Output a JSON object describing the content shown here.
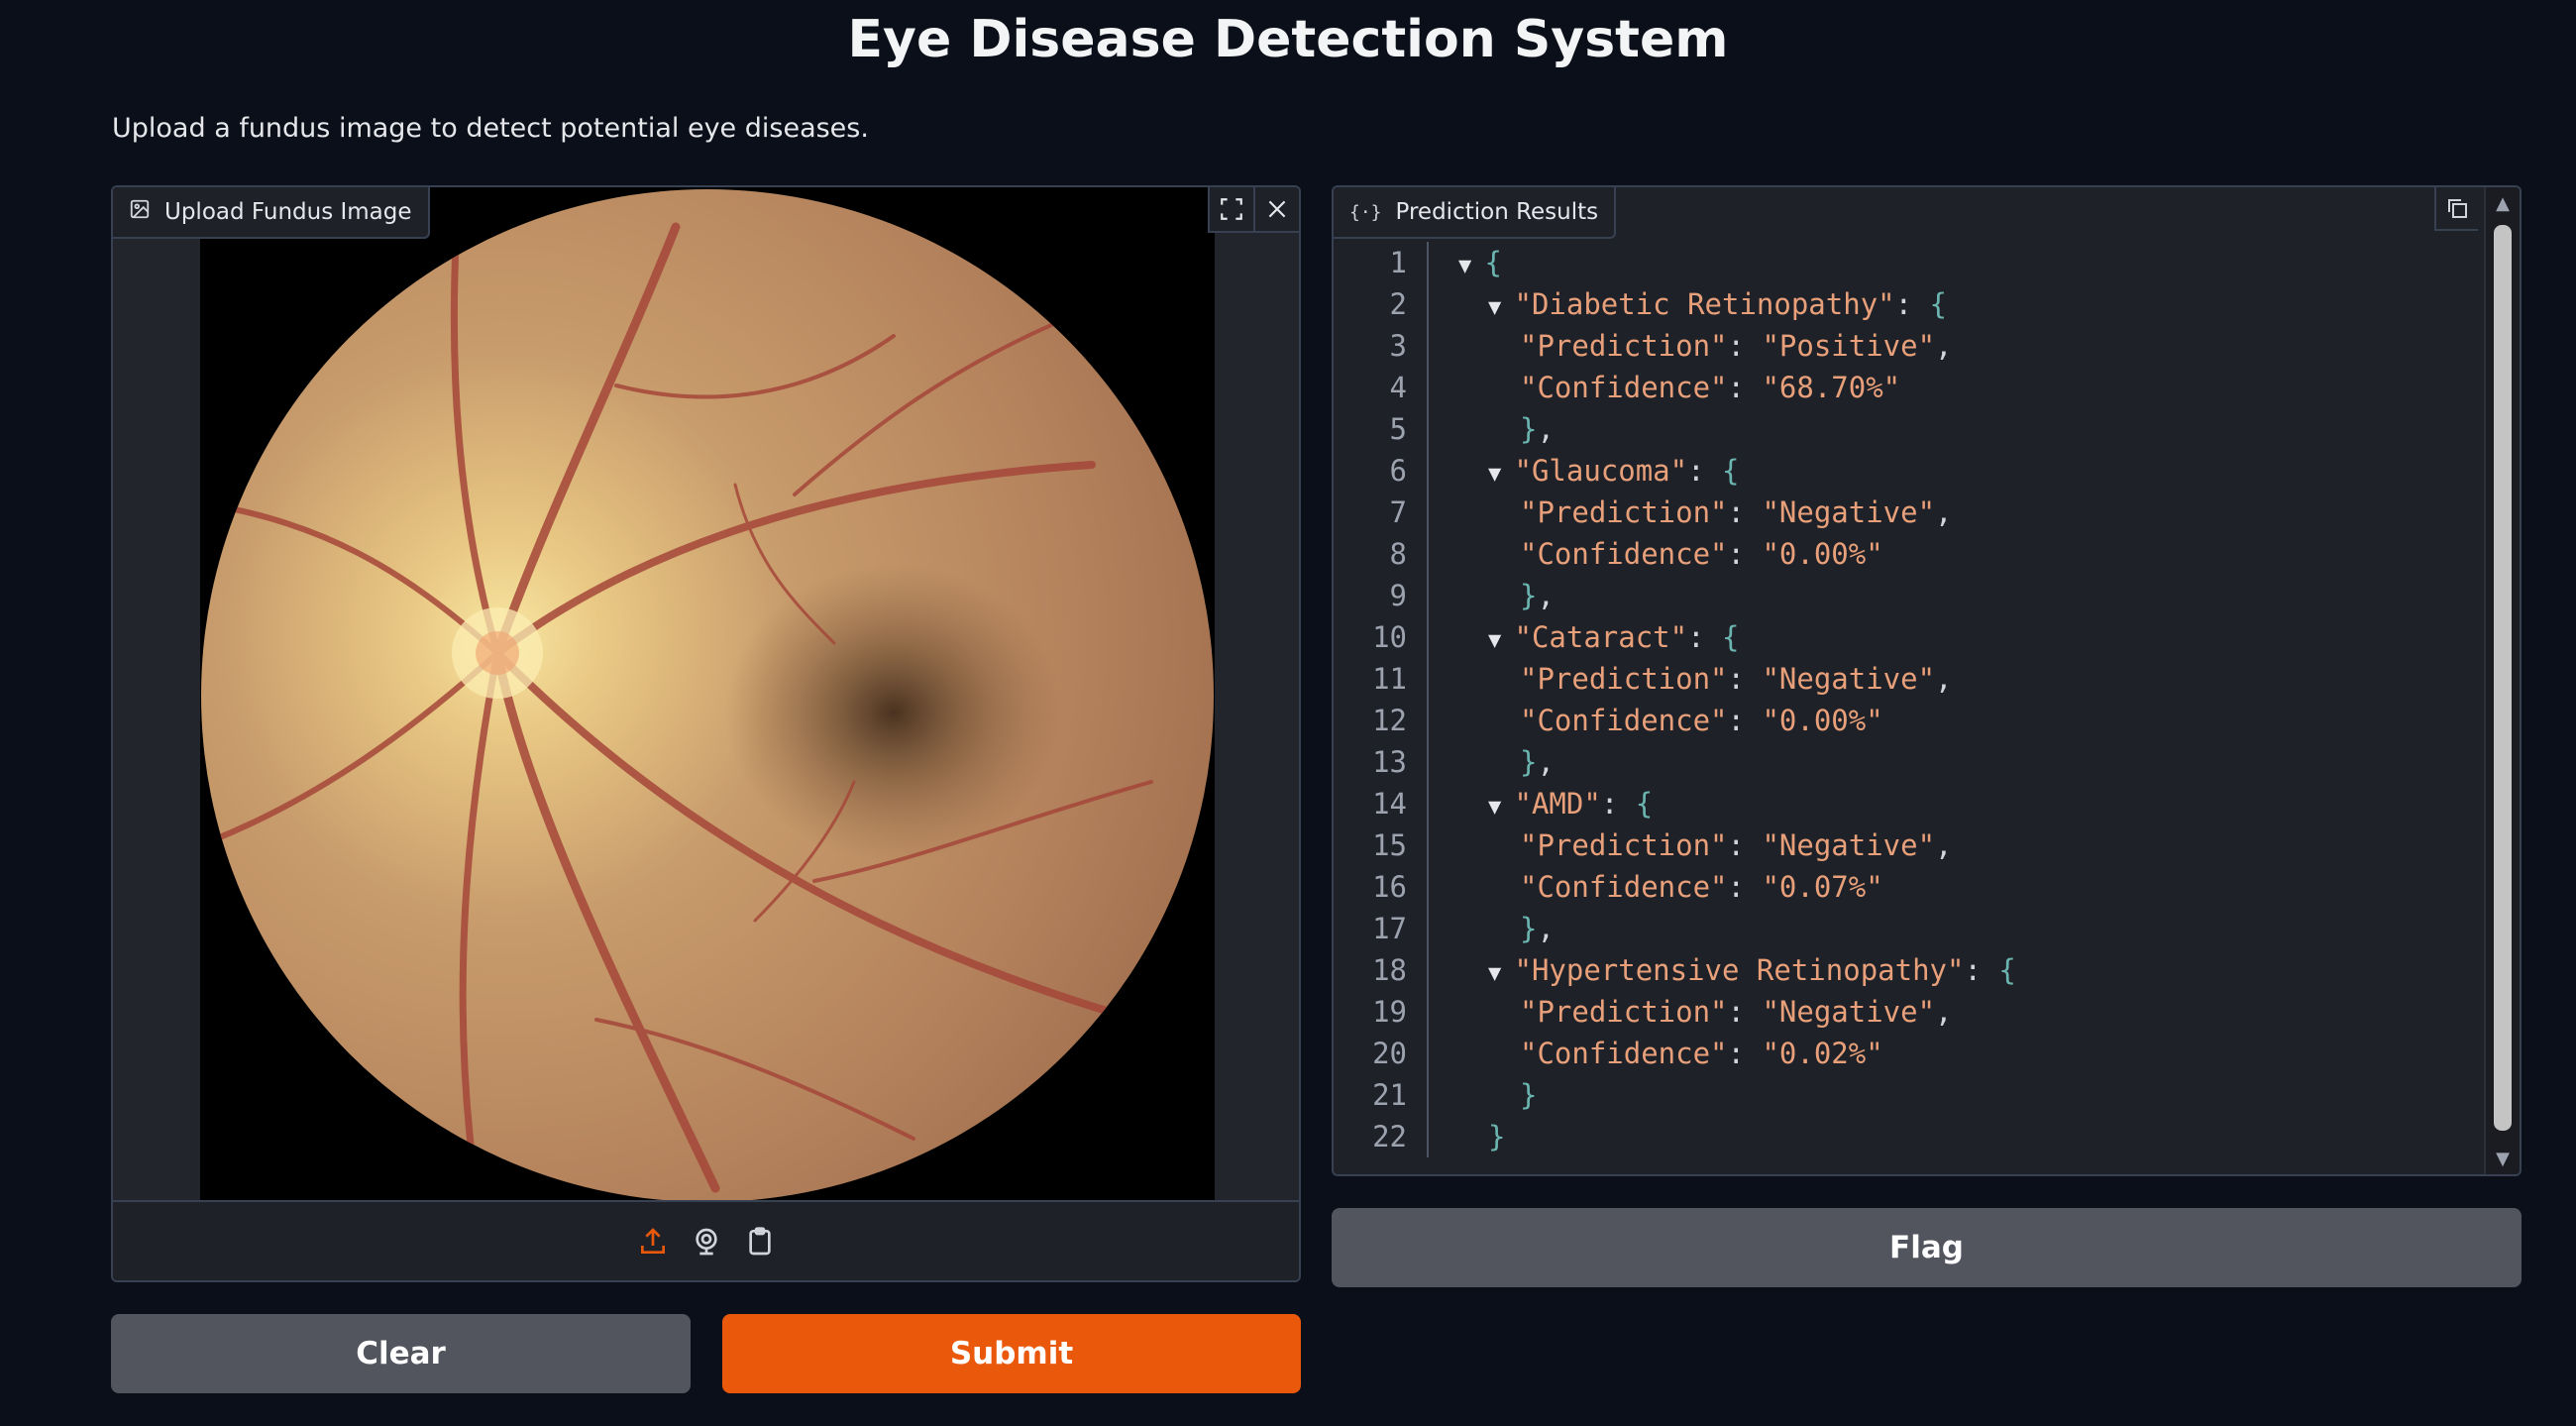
{
  "header": {
    "title": "Eye Disease Detection System",
    "description": "Upload a fundus image to detect potential eye diseases."
  },
  "upload": {
    "label": "Upload Fundus Image"
  },
  "results": {
    "label": "Prediction Results",
    "line_numbers": [
      "1",
      "2",
      "3",
      "4",
      "5",
      "6",
      "7",
      "8",
      "9",
      "10",
      "11",
      "12",
      "13",
      "14",
      "15",
      "16",
      "17",
      "18",
      "19",
      "20",
      "21",
      "22"
    ],
    "diseases": [
      {
        "name": "\"Diabetic Retinopathy\"",
        "prediction": "\"Positive\"",
        "confidence": "\"68.70%\""
      },
      {
        "name": "\"Glaucoma\"",
        "prediction": "\"Negative\"",
        "confidence": "\"0.00%\""
      },
      {
        "name": "\"Cataract\"",
        "prediction": "\"Negative\"",
        "confidence": "\"0.00%\""
      },
      {
        "name": "\"AMD\"",
        "prediction": "\"Negative\"",
        "confidence": "\"0.07%\""
      },
      {
        "name": "\"Hypertensive Retinopathy\"",
        "prediction": "\"Negative\"",
        "confidence": "\"0.02%\""
      }
    ],
    "prediction_key": "\"Prediction\"",
    "confidence_key": "\"Confidence\""
  },
  "buttons": {
    "clear": "Clear",
    "submit": "Submit",
    "flag": "Flag"
  },
  "colors": {
    "accent": "#ea580c",
    "background": "#0b0f19",
    "json_key": "#e8a07a",
    "json_brace": "#6bb5b0"
  }
}
